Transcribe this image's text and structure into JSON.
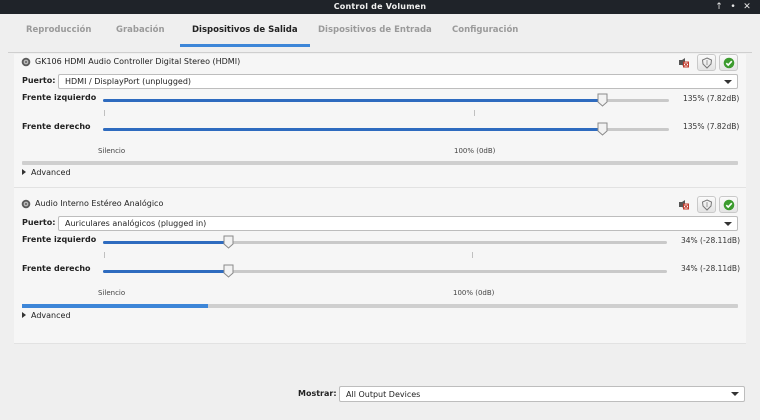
{
  "window": {
    "title": "Control de Volumen"
  },
  "tabs": [
    {
      "label": "Reproducción",
      "active": false
    },
    {
      "label": "Grabación",
      "active": false
    },
    {
      "label": "Dispositivos de Salida",
      "active": true
    },
    {
      "label": "Dispositivos de Entrada",
      "active": false
    },
    {
      "label": "Configuración",
      "active": false
    }
  ],
  "devices": [
    {
      "name": "GK106 HDMI Audio Controller Digital Stereo (HDMI)",
      "port_label": "Puerto:",
      "port_value": "HDMI / DisplayPort (unplugged)",
      "channels": [
        {
          "label": "Frente izquierdo",
          "value": "135% (7.82dB)",
          "level_percent": 135
        },
        {
          "label": "Frente derecho",
          "value": "135% (7.82dB)",
          "level_percent": 135
        }
      ],
      "scale_marks": {
        "silence": "Silencio",
        "unity": "100% (0dB)"
      },
      "peak_level": 0,
      "advanced_label": "Advanced"
    },
    {
      "name": "Audio Interno Estéreo Analógico",
      "port_label": "Puerto:",
      "port_value": "Auriculares analógicos (plugged in)",
      "channels": [
        {
          "label": "Frente izquierdo",
          "value": "34% (-28.11dB)",
          "level_percent": 34
        },
        {
          "label": "Frente derecho",
          "value": "34% (-28.11dB)",
          "level_percent": 34
        }
      ],
      "scale_marks": {
        "silence": "Silencio",
        "unity": "100% (0dB)"
      },
      "peak_level": 0.26,
      "advanced_label": "Advanced"
    }
  ],
  "footer": {
    "show_label": "Mostrar:",
    "show_value": "All Output Devices"
  },
  "icons": {
    "speaker": "speaker-icon",
    "mute": "mute-icon",
    "lock": "lock-channels-icon",
    "default": "set-default-icon"
  },
  "colors": {
    "accent": "#3d86d8",
    "slider_fill": "#2e6bbf",
    "check_green": "#3c9b2e",
    "mute_red": "#c0392b"
  }
}
